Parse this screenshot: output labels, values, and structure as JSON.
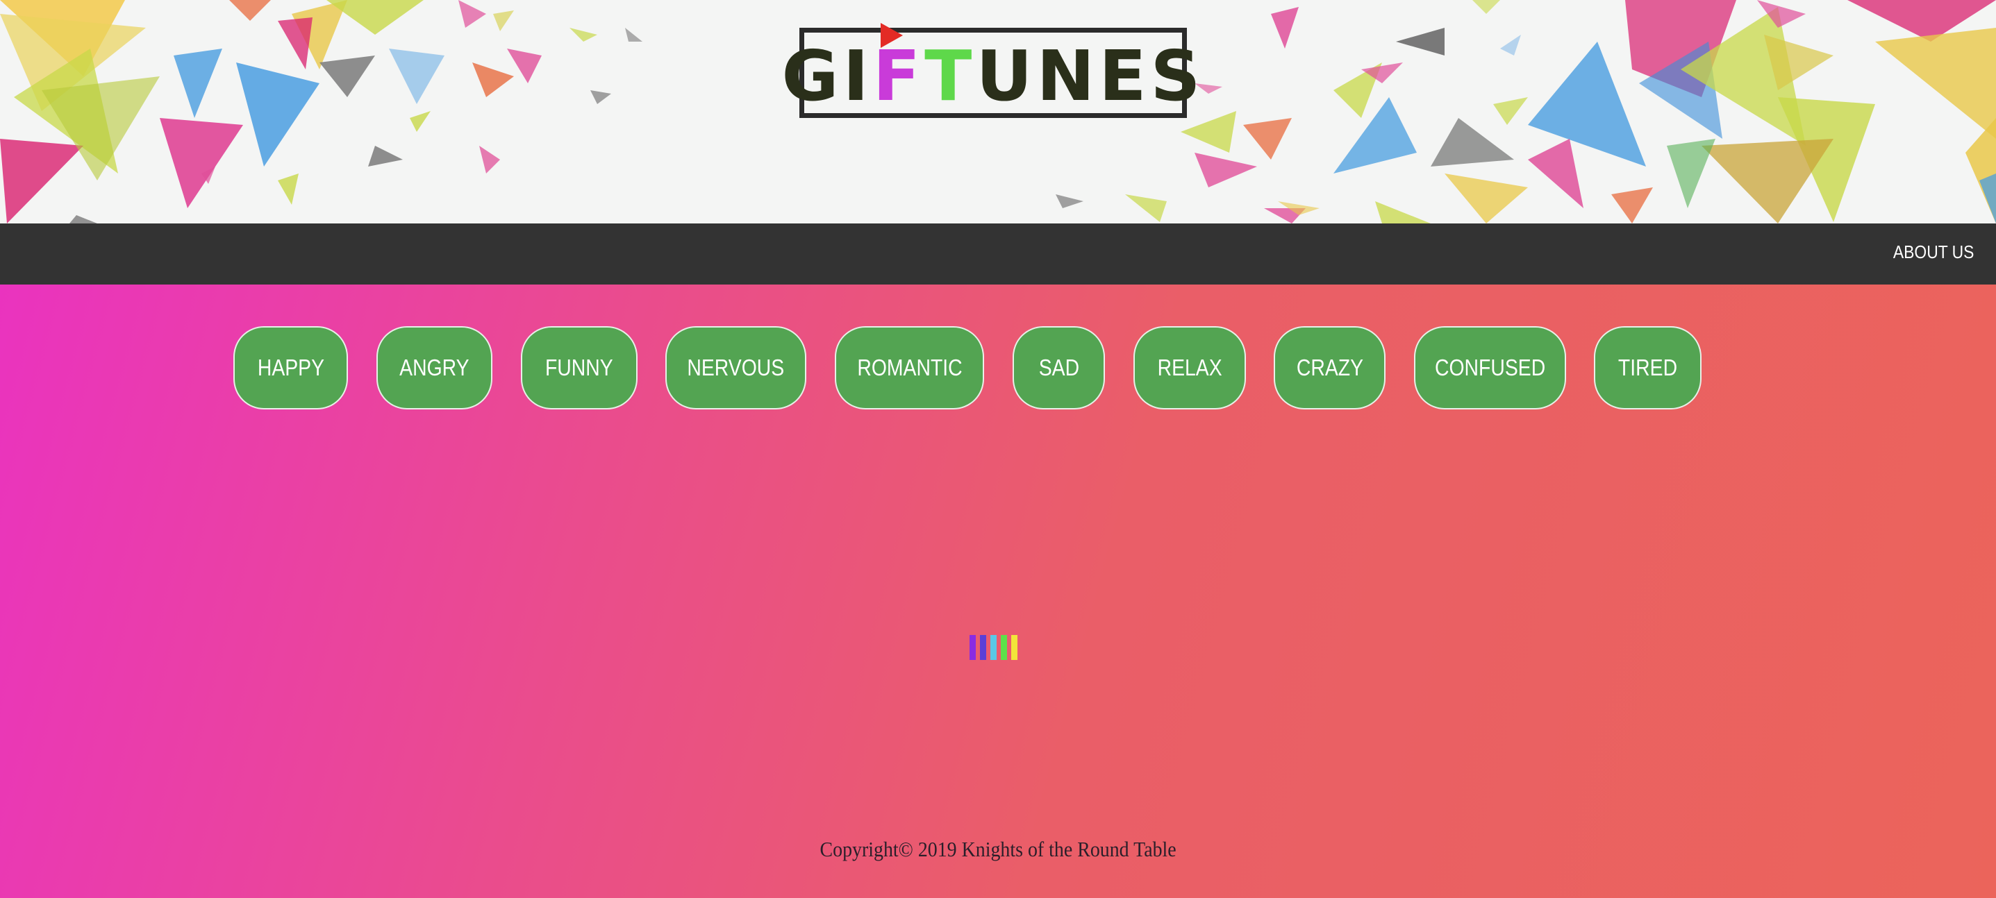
{
  "header": {
    "logo": {
      "text_segments": [
        {
          "text": "G",
          "color": "#2a2f1a"
        },
        {
          "text": "I",
          "color": "#2a2f1a"
        },
        {
          "text": "F",
          "color": "#c93bd9"
        },
        {
          "text": "T",
          "color": "#5ed84a"
        },
        {
          "text": "UNES",
          "color": "#2a2f1a"
        }
      ],
      "play_icon_color": "#e32b25"
    }
  },
  "nav": {
    "about_label": "ABOUT US"
  },
  "moods": [
    {
      "label": "HAPPY"
    },
    {
      "label": "ANGRY"
    },
    {
      "label": "FUNNY"
    },
    {
      "label": "NERVOUS"
    },
    {
      "label": "ROMANTIC"
    },
    {
      "label": "SAD"
    },
    {
      "label": "RELAX"
    },
    {
      "label": "CRAZY"
    },
    {
      "label": "CONFUSED"
    },
    {
      "label": "TIRED"
    }
  ],
  "loader": {
    "bar_colors": [
      "#8a2be2",
      "#5b3fd6",
      "#5ac8e6",
      "#5ee04a",
      "#f2e53a"
    ]
  },
  "footer": {
    "copyright": "Copyright© 2019 Knights of the Round Table"
  },
  "colors": {
    "navbar": "#333333",
    "mood_button": "#53a452",
    "gradient_start": "#ea33bf",
    "gradient_end": "#eb645b"
  }
}
